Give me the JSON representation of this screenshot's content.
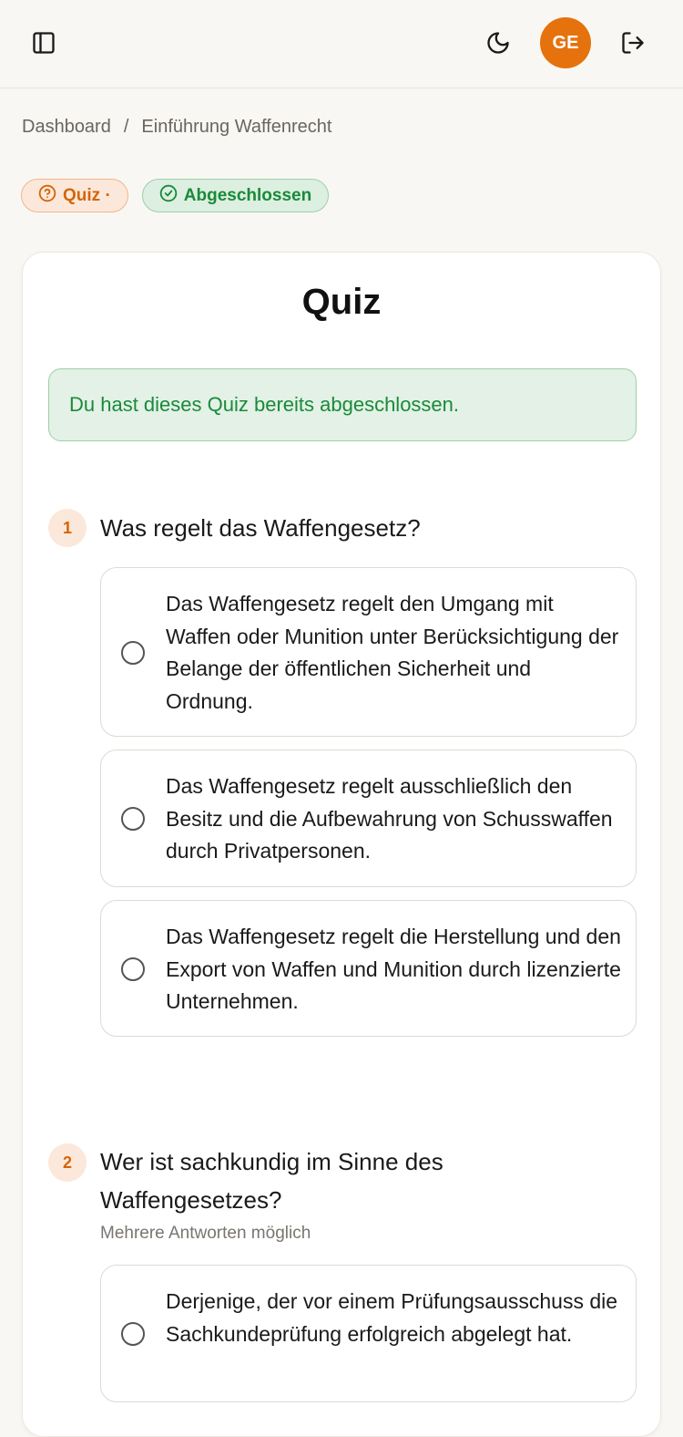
{
  "header": {
    "avatar_initials": "GE",
    "icons": [
      "sidebar-toggle-icon",
      "moon-icon",
      "logout-icon"
    ]
  },
  "breadcrumb": {
    "items": [
      "Dashboard",
      "Einführung Waffenrecht"
    ],
    "separator": "/"
  },
  "badges": {
    "quiz_label": "Quiz ·",
    "status_label": "Abgeschlossen"
  },
  "quiz": {
    "title": "Quiz",
    "notice": "Du hast dieses Quiz bereits abgeschlossen.",
    "questions": [
      {
        "number": "1",
        "text": "Was regelt das Waffengesetz?",
        "options": [
          "Das Waffengesetz regelt den Umgang mit Waffen oder Munition unter Berücksichtigung der Belange der öffentlichen Sicherheit und Ordnung.",
          "Das Waffengesetz regelt ausschließlich den Besitz und die Aufbewahrung von Schusswaffen durch Privatpersonen.",
          "Das Waffengesetz regelt die Herstellung und den Export von Waffen und Munition durch lizenzierte Unternehmen."
        ]
      },
      {
        "number": "2",
        "text": "Wer ist sachkundig im Sinne des Waffengesetzes?",
        "hint": "Mehrere Antworten möglich",
        "options": [
          "Derjenige, der vor einem Prüfungsausschuss die Sachkundeprüfung erfolgreich abgelegt hat."
        ]
      }
    ]
  },
  "colors": {
    "accent": "#e5720d",
    "success": "#1a8a3a",
    "background": "#f9f7f3"
  }
}
